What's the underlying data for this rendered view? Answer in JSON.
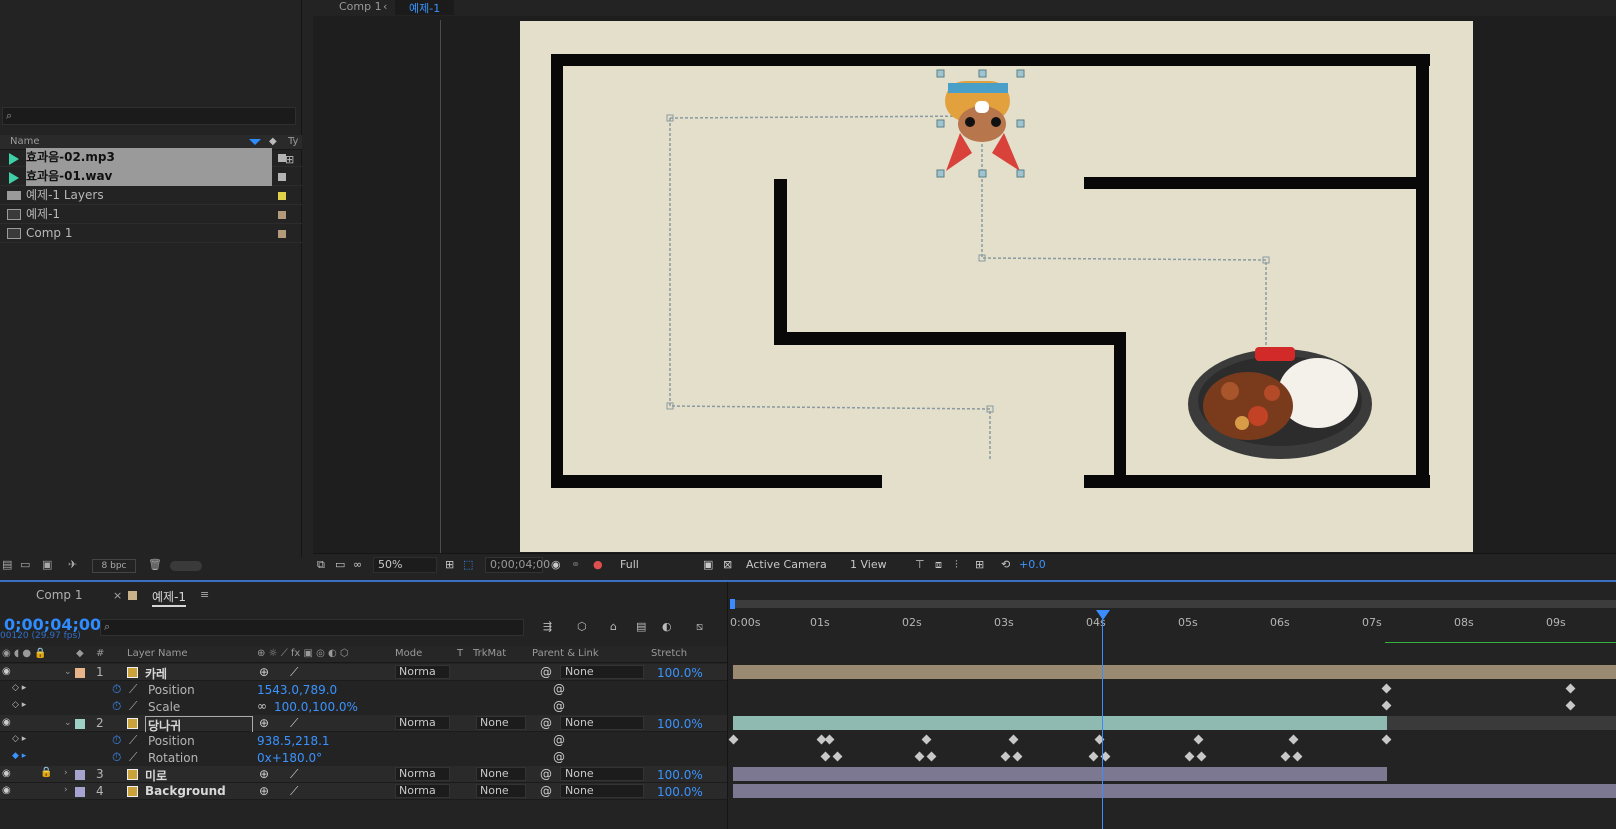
{
  "viewer": {
    "tabs": [
      "Comp 1",
      "예제-1"
    ],
    "toolbar": {
      "zoom": "50%",
      "timecode": "0;00;04;00",
      "resolution": "Full",
      "camera": "Active Camera",
      "views": "1 View",
      "exposure": "+0.0"
    }
  },
  "project": {
    "columns": {
      "name": "Name",
      "type": "Ty"
    },
    "items": [
      {
        "name": "효과음-02.mp3",
        "selected": true,
        "label_color": "#b4b4b4"
      },
      {
        "name": "효과음-01.wav",
        "selected": true,
        "label_color": "#b4b4b4"
      },
      {
        "name": "예제-1 Layers",
        "selected": false,
        "label_color": "#e1d14a"
      },
      {
        "name": "예제-1",
        "selected": false,
        "label_color": "#b39a7a"
      },
      {
        "name": "Comp 1",
        "selected": false,
        "label_color": "#b39a7a"
      }
    ],
    "bpc": "8 bpc"
  },
  "timeline": {
    "tabs": [
      "Comp 1",
      "예제-1"
    ],
    "timecode": "0;00;04;00",
    "fps": "00120 (29.97 fps)",
    "columns": {
      "layer_name": "Layer Name",
      "mode": "Mode",
      "t": "T",
      "trkmat": "TrkMat",
      "parent": "Parent & Link",
      "stretch": "Stretch"
    },
    "ruler": [
      "0:00s",
      "01s",
      "02s",
      "03s",
      "04s",
      "05s",
      "06s",
      "07s",
      "08s",
      "09s"
    ],
    "layers": [
      {
        "num": "1",
        "name": "카레",
        "color": "#e8b48a",
        "mode": "Norma",
        "trkmat": "",
        "parent": "None",
        "stretch": "100.0%",
        "props": [
          {
            "name": "Position",
            "value": "1543.0,789.0"
          },
          {
            "name": "Scale",
            "value": "100.0,100.0%"
          }
        ]
      },
      {
        "num": "2",
        "name": "당나귀",
        "color": "#9fd0c4",
        "mode": "Norma",
        "trkmat": "None",
        "parent": "None",
        "stretch": "100.0%",
        "props": [
          {
            "name": "Position",
            "value": "938.5,218.1"
          },
          {
            "name": "Rotation",
            "value": "0x+180.0°"
          }
        ]
      },
      {
        "num": "3",
        "name": "미로",
        "color": "#a7a3cf",
        "mode": "Norma",
        "trkmat": "None",
        "parent": "None",
        "stretch": "100.0%",
        "props": []
      },
      {
        "num": "4",
        "name": "Background",
        "color": "#a7a3cf",
        "mode": "Norma",
        "trkmat": "None",
        "parent": "None",
        "stretch": "100.0%",
        "props": []
      }
    ]
  }
}
